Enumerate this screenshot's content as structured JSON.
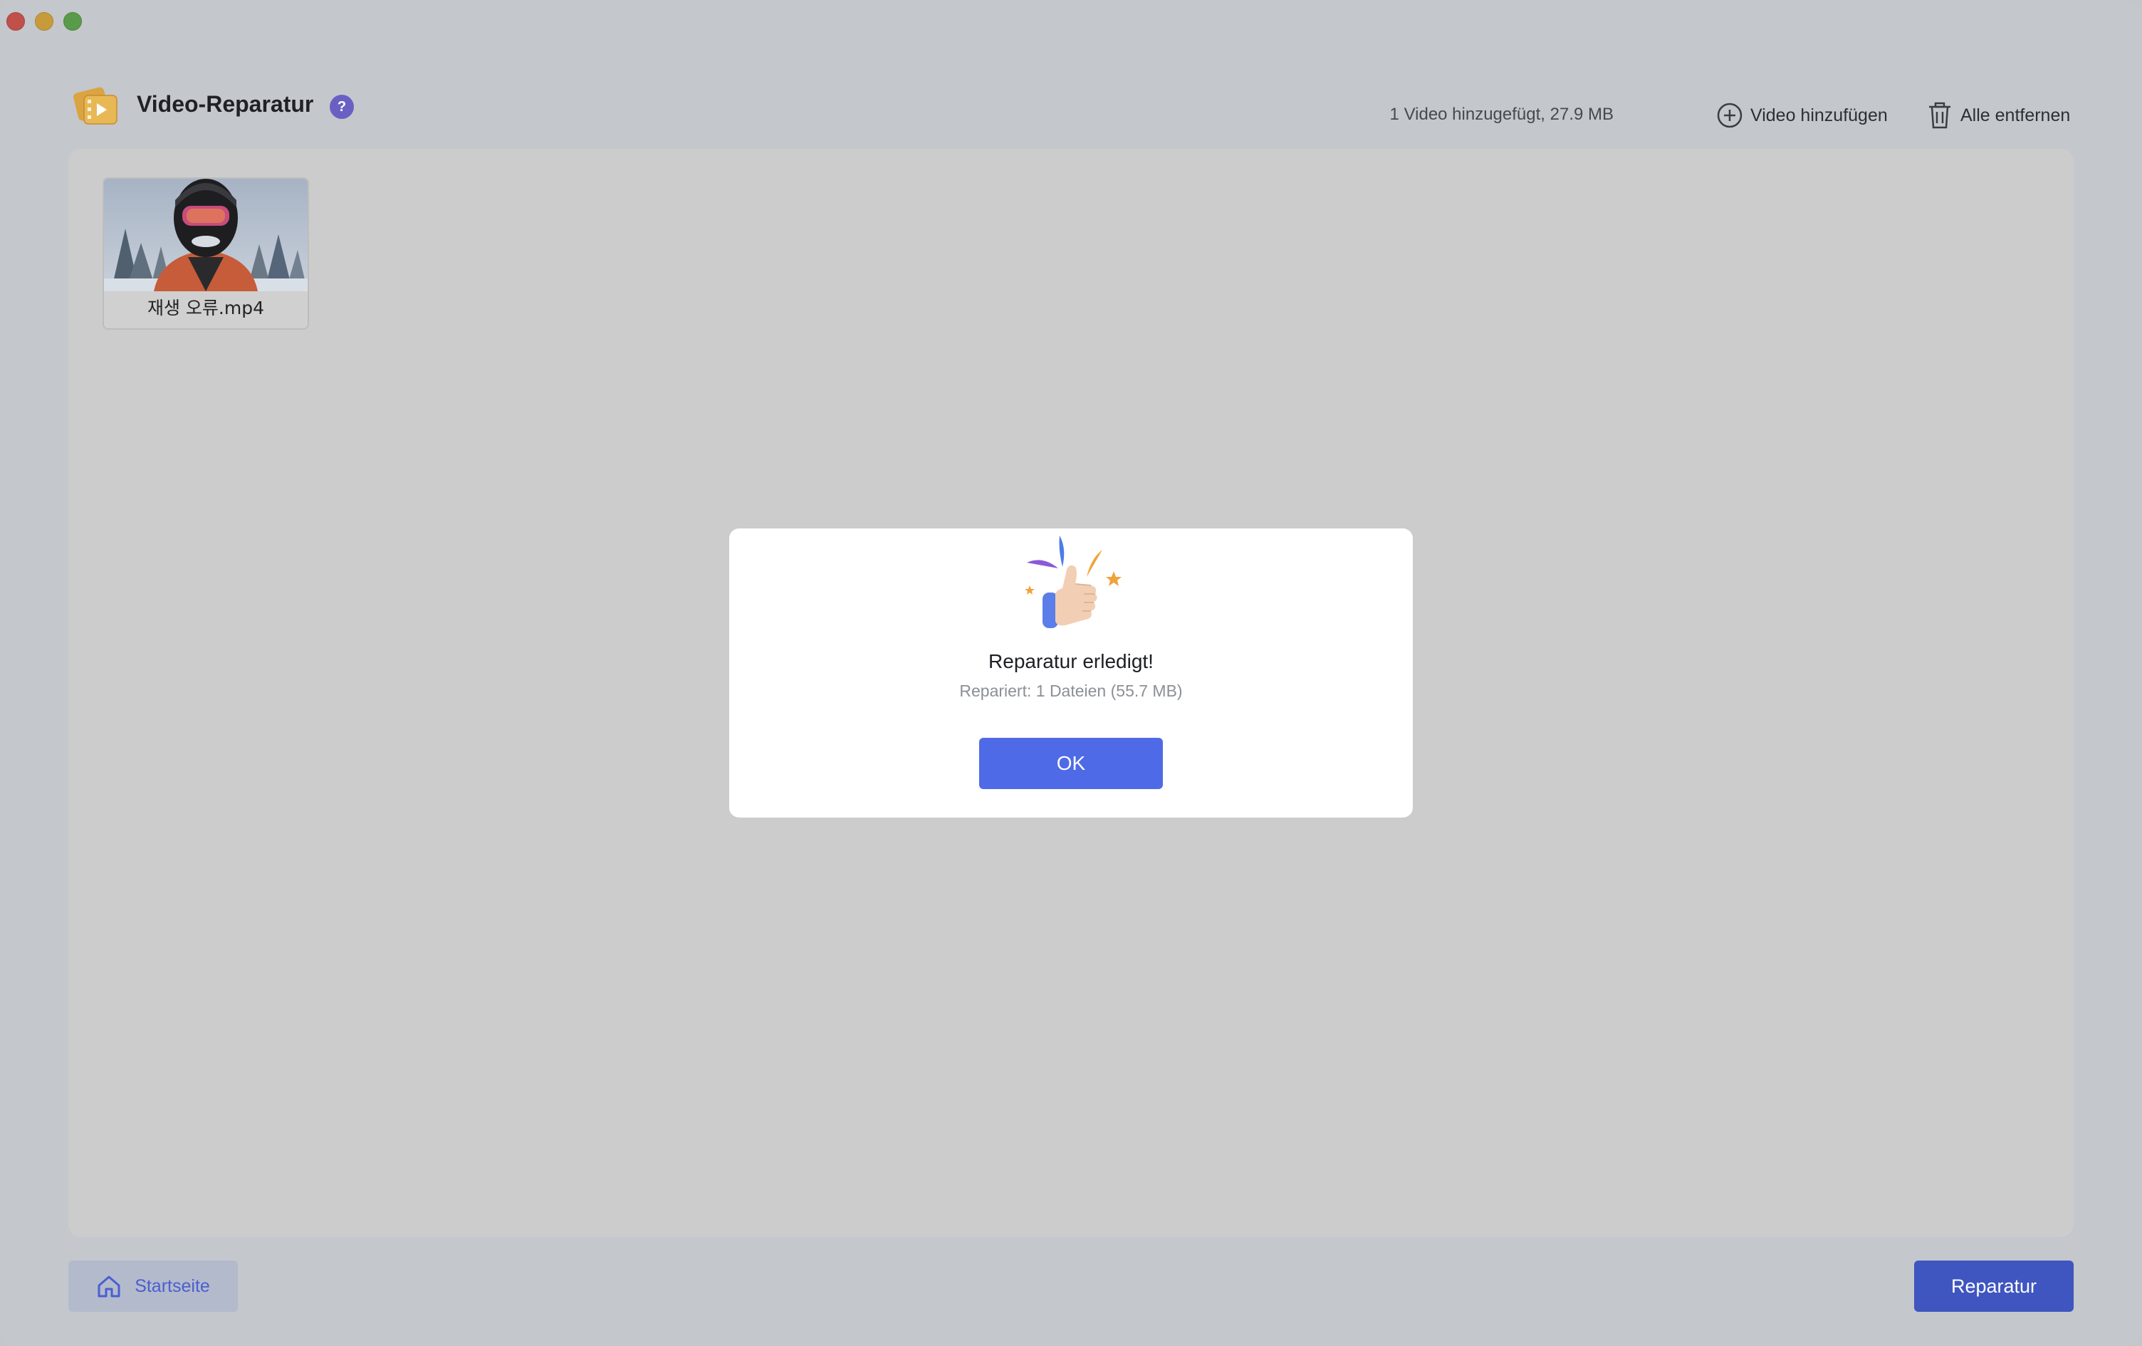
{
  "window": {
    "controls": [
      "close",
      "minimize",
      "maximize"
    ]
  },
  "header": {
    "title": "Video-Reparatur",
    "help_label": "?",
    "stats": "1 Video hinzugefügt, 27.9 MB",
    "add_video_label": "Video hinzufügen",
    "remove_all_label": "Alle entfernen"
  },
  "files": [
    {
      "name": "재생 오류.mp4"
    }
  ],
  "dialog": {
    "title": "Reparatur erledigt!",
    "subtitle": "Repariert: 1 Dateien (55.7 MB)",
    "ok_label": "OK"
  },
  "footer": {
    "home_label": "Startseite",
    "repair_label": "Reparatur"
  },
  "colors": {
    "accent": "#4f6ae6",
    "repair_button": "#3f55c0",
    "help_badge": "#6a60c4"
  }
}
